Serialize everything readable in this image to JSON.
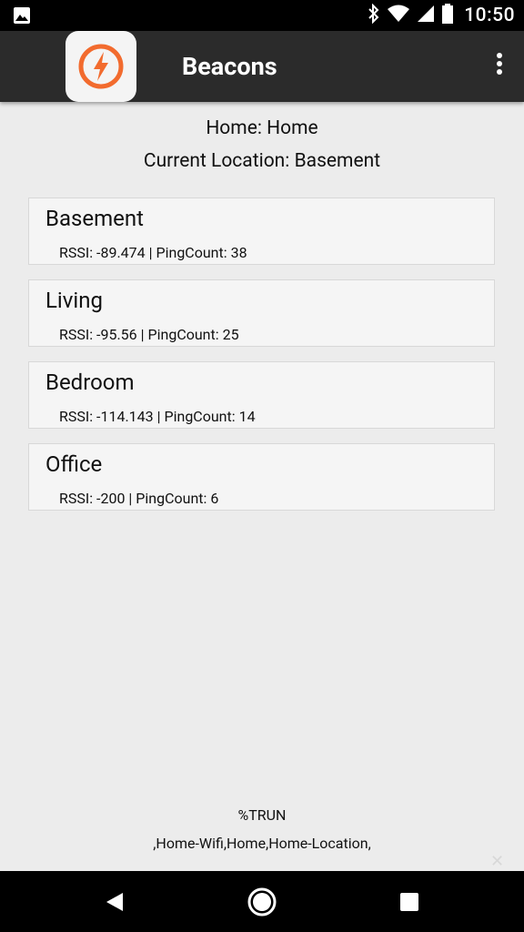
{
  "status_bar": {
    "time": "10:50",
    "icons": [
      "image-icon",
      "bluetooth-icon",
      "wifi-icon",
      "signal-icon",
      "battery-icon"
    ]
  },
  "app_bar": {
    "title": "Beacons",
    "logo_icon": "lightning-bolt-icon",
    "accent_color": "#f26b2e",
    "menu_icon": "more-vert-icon"
  },
  "home": {
    "home_line": "Home: Home",
    "location_line": "Current Location: Basement"
  },
  "beacons": [
    {
      "name": "Basement",
      "stats": "RSSI: -89.474 | PingCount: 38"
    },
    {
      "name": "Living",
      "stats": "RSSI: -95.56 | PingCount: 25"
    },
    {
      "name": "Bedroom",
      "stats": "RSSI: -114.143 | PingCount: 14"
    },
    {
      "name": "Office",
      "stats": "RSSI: -200 | PingCount: 6"
    }
  ],
  "footer": {
    "line1": "%TRUN",
    "line2": ",Home-Wifi,Home,Home-Location,"
  },
  "nav_bar": {
    "icons": [
      "back-icon",
      "home-icon",
      "recents-icon"
    ]
  }
}
